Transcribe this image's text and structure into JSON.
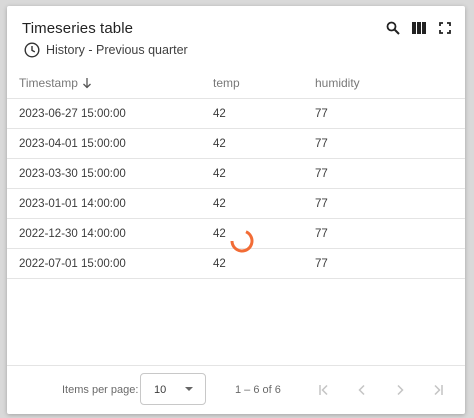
{
  "widget": {
    "title": "Timeseries table",
    "timewindow_label": "History - Previous quarter",
    "icons": {
      "search": "search-icon",
      "columns": "columns-icon",
      "fullscreen": "fullscreen-icon",
      "history": "clock-icon"
    }
  },
  "table": {
    "columns": [
      "Timestamp",
      "temp",
      "humidity"
    ],
    "sort": {
      "column": "Timestamp",
      "direction": "descending"
    },
    "rows": [
      [
        "2023-06-27 15:00:00",
        "42",
        "77"
      ],
      [
        "2023-04-01 15:00:00",
        "42",
        "77"
      ],
      [
        "2023-03-30 15:00:00",
        "42",
        "77"
      ],
      [
        "2023-01-01 14:00:00",
        "42",
        "77"
      ],
      [
        "2022-12-30 14:00:00",
        "42",
        "77"
      ],
      [
        "2022-07-01 15:00:00",
        "42",
        "77"
      ]
    ],
    "loading": true
  },
  "paginator": {
    "items_per_page_label": "Items per page:",
    "items_per_page_value": "10",
    "range_label": "1 – 6 of 6",
    "icons": [
      "first-page-icon",
      "previous-page-icon",
      "next-page-icon",
      "last-page-icon"
    ]
  },
  "colors": {
    "spinner": "#f26c36",
    "divider": "#e4e4e4",
    "disabled_icon": "#c4c4c4"
  }
}
